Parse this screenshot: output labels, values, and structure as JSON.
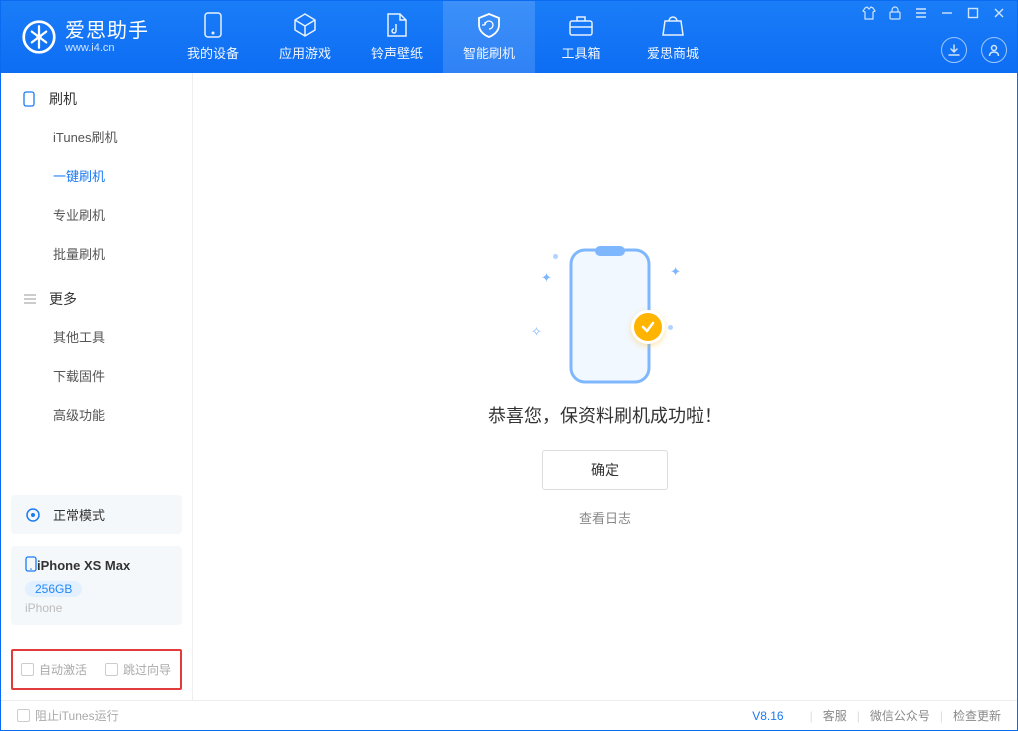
{
  "header": {
    "logo": {
      "title": "爱思助手",
      "sub": "www.i4.cn"
    },
    "nav": [
      {
        "label": "我的设备"
      },
      {
        "label": "应用游戏"
      },
      {
        "label": "铃声壁纸"
      },
      {
        "label": "智能刷机"
      },
      {
        "label": "工具箱"
      },
      {
        "label": "爱思商城"
      }
    ]
  },
  "sidebar": {
    "groups": [
      {
        "title": "刷机",
        "items": [
          {
            "label": "iTunes刷机"
          },
          {
            "label": "一键刷机",
            "active": true
          },
          {
            "label": "专业刷机"
          },
          {
            "label": "批量刷机"
          }
        ]
      },
      {
        "title": "更多",
        "items": [
          {
            "label": "其他工具"
          },
          {
            "label": "下载固件"
          },
          {
            "label": "高级功能"
          }
        ]
      }
    ],
    "mode": {
      "label": "正常模式"
    },
    "device": {
      "name": "iPhone XS Max",
      "capacity": "256GB",
      "type": "iPhone"
    },
    "options": {
      "auto_activate": "自动激活",
      "skip_wizard": "跳过向导"
    }
  },
  "main": {
    "success_title": "恭喜您，保资料刷机成功啦！",
    "ok_label": "确定",
    "view_log": "查看日志"
  },
  "footer": {
    "stop_itunes": "阻止iTunes运行",
    "version": "V8.16",
    "support": "客服",
    "wechat": "微信公众号",
    "check_update": "检查更新"
  }
}
